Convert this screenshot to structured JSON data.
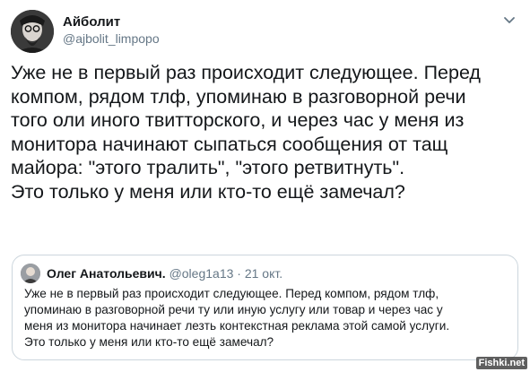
{
  "tweet": {
    "author_name": "Айболит",
    "author_handle": "@ajbolit_limpopo",
    "text": "Уже не в первый раз происходит следующее. Перед\nкомпом, рядом тлф, упоминаю в разговорной речи\nтого оли иного твитторского, и через час у меня из\nмонитора начинают сыпаться сообщения от тащ\nмайора: \"этого тралить\", \"этого ретвитнуть\".\nЭто только у меня или кто-то ещё замечал?"
  },
  "quoted": {
    "author_name": "Олег Анатольевич.",
    "author_handle": "@oleg1a13",
    "separator": "·",
    "date": "21 окт.",
    "text": "Уже не в первый раз происходит следующее. Перед компом, рядом тлф,\nупоминаю в разговорной речи ту или иную услугу или товар и через час у\nменя из монитора начинает лезть контекстная реклама этой самой услуги.\nЭто только у меня или кто-то ещё замечал?"
  },
  "watermark": "Fishki.net",
  "icons": {
    "menu": "chevron-down-icon"
  },
  "colors": {
    "text": "#14171a",
    "secondary": "#657786",
    "border": "#ccd6dd"
  }
}
